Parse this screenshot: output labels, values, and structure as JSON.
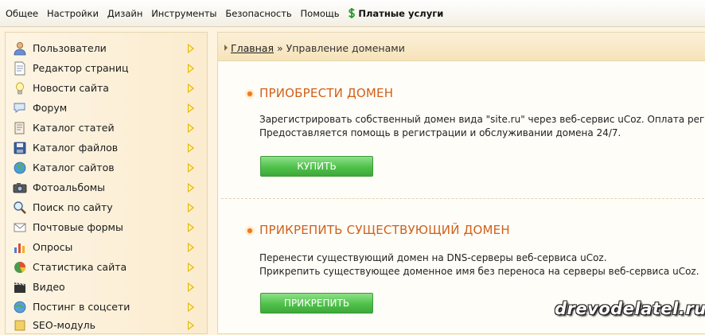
{
  "topbar": {
    "items": [
      "Общее",
      "Настройки",
      "Дизайн",
      "Инструменты",
      "Безопасность",
      "Помощь"
    ],
    "paid_label": "Платные услуги"
  },
  "sidebar": {
    "items": [
      {
        "label": "Пользователи",
        "icon": "users-icon"
      },
      {
        "label": "Редактор страниц",
        "icon": "page-editor-icon"
      },
      {
        "label": "Новости сайта",
        "icon": "news-icon"
      },
      {
        "label": "Форум",
        "icon": "forum-icon"
      },
      {
        "label": "Каталог статей",
        "icon": "articles-icon"
      },
      {
        "label": "Каталог файлов",
        "icon": "files-icon"
      },
      {
        "label": "Каталог сайтов",
        "icon": "sites-icon"
      },
      {
        "label": "Фотоальбомы",
        "icon": "camera-icon"
      },
      {
        "label": "Поиск по сайту",
        "icon": "search-icon"
      },
      {
        "label": "Почтовые формы",
        "icon": "mail-icon"
      },
      {
        "label": "Опросы",
        "icon": "poll-icon"
      },
      {
        "label": "Статистика сайта",
        "icon": "stats-icon"
      },
      {
        "label": "Видео",
        "icon": "video-icon"
      },
      {
        "label": "Постинг в соцсети",
        "icon": "social-icon"
      },
      {
        "label": "SEO-модуль",
        "icon": "seo-icon"
      }
    ]
  },
  "breadcrumb": {
    "home": "Главная",
    "separator": "»",
    "current": "Управление доменами"
  },
  "buy": {
    "title": "ПРИОБРЕСТИ ДОМЕН",
    "line1": "Зарегистрировать собственный домен вида \"site.ru\" через веб-сервис uCoz. Оплата регист",
    "line2": "Предоставляется помощь в регистрации и обслуживании домена 24/7.",
    "button": "КУПИТЬ"
  },
  "attach": {
    "title": "ПРИКРЕПИТЬ СУЩЕСТВУЮЩИЙ ДОМЕН",
    "line1": "Перенести существующий домен на DNS-серверы веб-сервиса uCoz.",
    "line2": "Прикрепить существующее доменное имя без переноса на серверы веб-сервиса uCoz.",
    "button": "ПРИКРЕПИТЬ"
  },
  "watermark": "drevodelatel.ru",
  "colors": {
    "accent": "#d0601a",
    "button": "#4fc14a",
    "arrow": "#e2b400"
  }
}
